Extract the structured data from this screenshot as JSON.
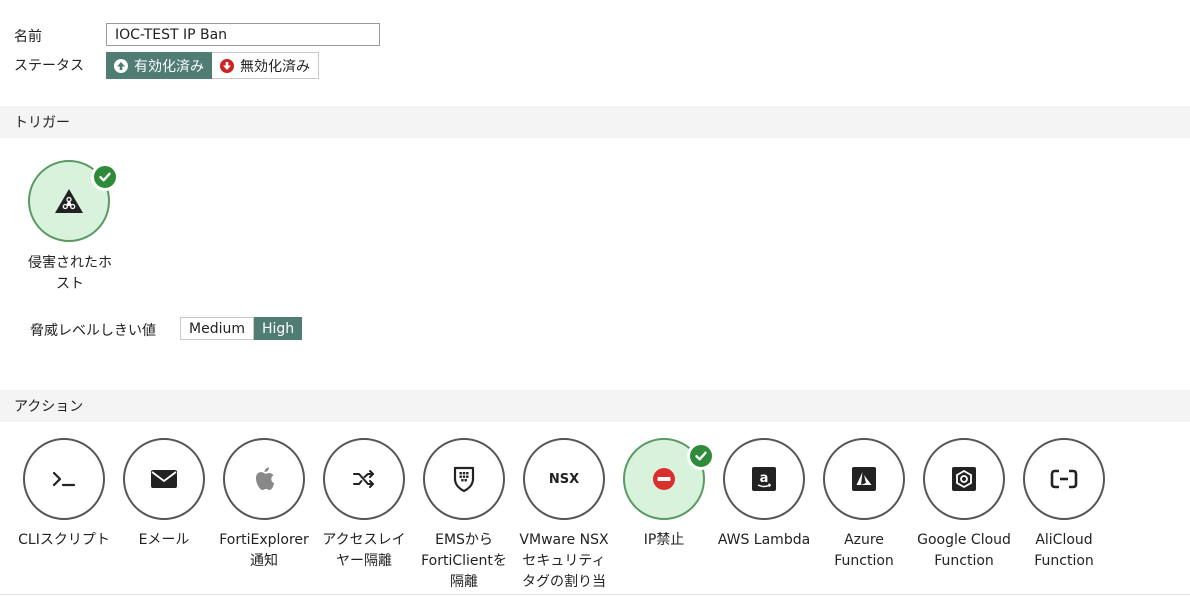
{
  "form": {
    "name_label": "名前",
    "name_value": "IOC-TEST IP Ban",
    "status_label": "ステータス",
    "status_enabled": "有効化済み",
    "status_disabled": "無効化済み"
  },
  "trigger": {
    "section_title": "トリガー",
    "item_label_line1": "侵害されたホ",
    "item_label_line2": "スト",
    "threshold_label": "脅威レベルしきい値",
    "threshold_options": [
      "Medium",
      "High"
    ],
    "threshold_selected": "High"
  },
  "action": {
    "section_title": "アクション",
    "items": [
      {
        "icon_text": ">_",
        "lines": [
          "CLIスクリプト"
        ]
      },
      {
        "icon_text": "",
        "lines": [
          "Eメール"
        ]
      },
      {
        "icon_text": "",
        "lines": [
          "FortiExplorer",
          "通知"
        ]
      },
      {
        "icon_text": "",
        "lines": [
          "アクセスレイ",
          "ヤー隔離"
        ]
      },
      {
        "icon_text": "",
        "lines": [
          "EMSから",
          "FortiClientを",
          "隔離"
        ]
      },
      {
        "icon_text": "NSX",
        "lines": [
          "VMware NSX",
          "セキュリティ",
          "タグの割り当"
        ]
      },
      {
        "icon_text": "",
        "lines": [
          "IP禁止"
        ]
      },
      {
        "icon_text": "",
        "lines": [
          "AWS Lambda"
        ]
      },
      {
        "icon_text": "",
        "lines": [
          "Azure",
          "Function"
        ]
      },
      {
        "icon_text": "",
        "lines": [
          "Google Cloud",
          "Function"
        ]
      },
      {
        "icon_text": "",
        "lines": [
          "AliCloud",
          "Function"
        ]
      }
    ]
  },
  "colors": {
    "accent": "#4f7d73",
    "selected_fill": "#d9f2dc",
    "check_green": "#2e8b3a",
    "enabled_icon": "#4f7d73",
    "disabled_icon": "#cc2222",
    "ban_icon": "#d9302c"
  }
}
